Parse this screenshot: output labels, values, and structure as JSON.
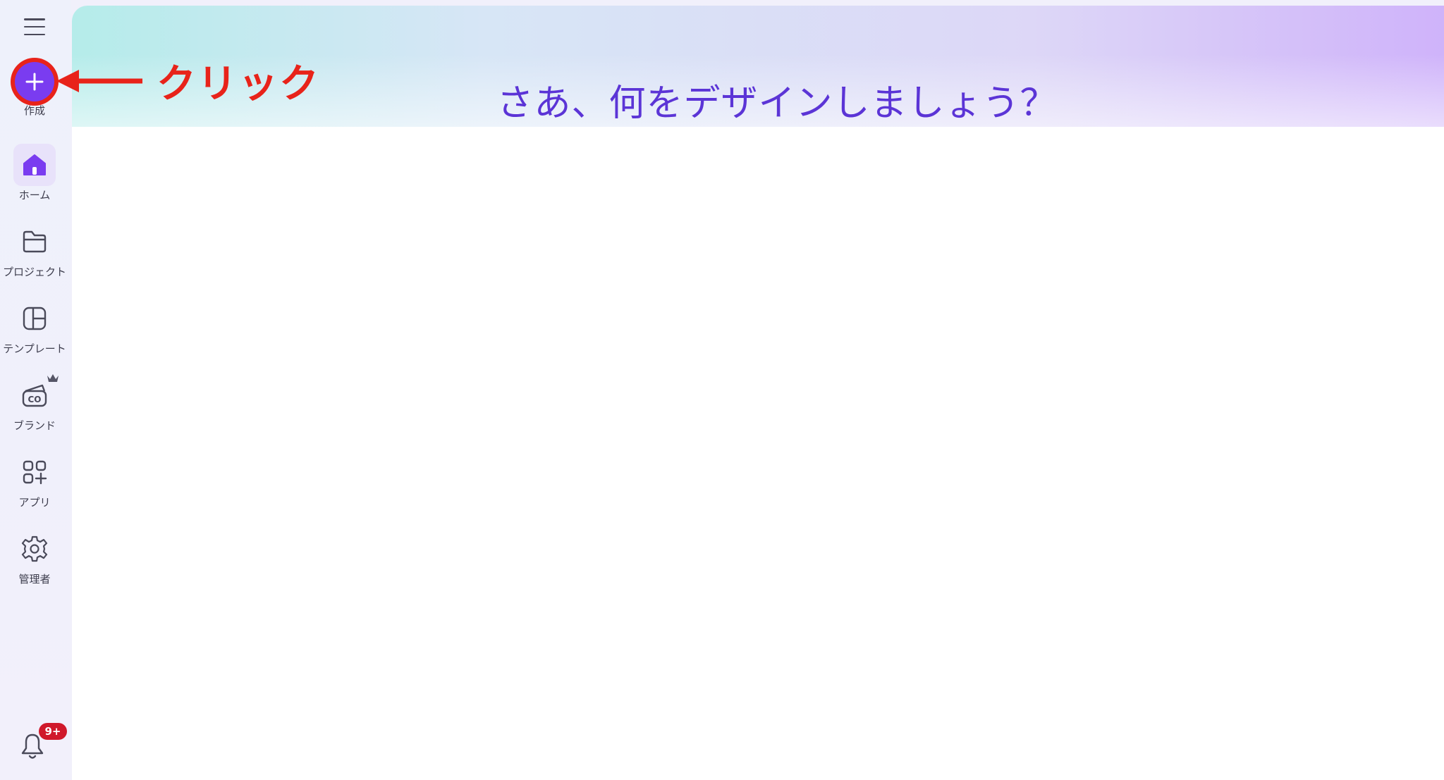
{
  "sidebar": {
    "create_label": "作成",
    "items": [
      {
        "label": "ホーム",
        "icon": "home-icon"
      },
      {
        "label": "プロジェクト",
        "icon": "folder-icon"
      },
      {
        "label": "テンプレート",
        "icon": "template-icon"
      },
      {
        "label": "ブランド",
        "icon": "brand-icon"
      },
      {
        "label": "アプリ",
        "icon": "apps-icon"
      },
      {
        "label": "管理者",
        "icon": "gear-icon"
      }
    ],
    "notifications_badge": "9+"
  },
  "banner": {
    "title": "さあ、何をデザインしましょう？"
  },
  "annotation": {
    "text": "クリック",
    "color": "#e8231a"
  },
  "colors": {
    "accent": "#7a3cf0",
    "title": "#5b34d6",
    "badge": "#d0192b"
  }
}
